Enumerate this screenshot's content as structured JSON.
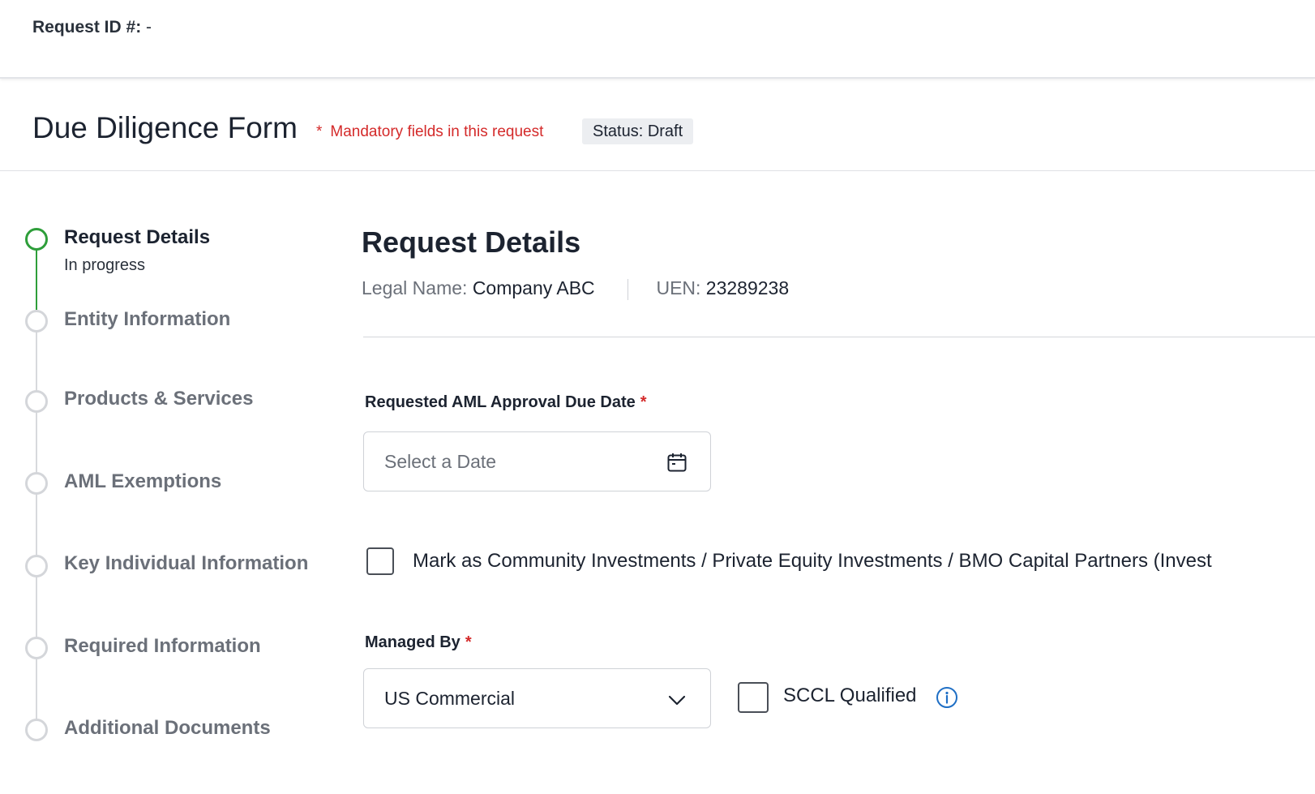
{
  "header": {
    "request_id_label": "Request ID #:",
    "request_id_value": "-"
  },
  "form": {
    "title": "Due Diligence Form",
    "mandatory_star": "*",
    "mandatory_note": "Mandatory fields in this request",
    "status": "Status: Draft"
  },
  "stepper": {
    "steps": [
      {
        "label": "Request Details",
        "sublabel": "In progress",
        "state": "active"
      },
      {
        "label": "Entity Information",
        "state": "pending"
      },
      {
        "label": "Products & Services",
        "state": "pending"
      },
      {
        "label": "AML Exemptions",
        "state": "pending"
      },
      {
        "label": "Key Individual Information",
        "state": "pending"
      },
      {
        "label": "Required Information",
        "state": "pending"
      },
      {
        "label": "Additional Documents",
        "state": "pending"
      }
    ]
  },
  "main": {
    "section_title": "Request Details",
    "legal_name_label": "Legal Name:",
    "legal_name_value": "Company ABC",
    "uen_label": "UEN:",
    "uen_value": "23289238",
    "due_date": {
      "label": "Requested AML Approval Due Date",
      "required_mark": "*",
      "placeholder": "Select a Date",
      "icon": "calendar-icon"
    },
    "community_checkbox": {
      "label": "Mark as Community Investments / Private Equity Investments / BMO Capital Partners (Invest",
      "checked": false
    },
    "managed_by": {
      "label": "Managed By",
      "required_mark": "*",
      "value": "US Commercial",
      "icon": "chevron-down-icon"
    },
    "sccl_checkbox": {
      "label": "SCCL Qualified",
      "checked": false,
      "icon": "info-icon"
    }
  },
  "colors": {
    "accent_green": "#2e9e3a",
    "mandatory_red": "#d42a2a",
    "info_blue": "#1f6fc5"
  }
}
